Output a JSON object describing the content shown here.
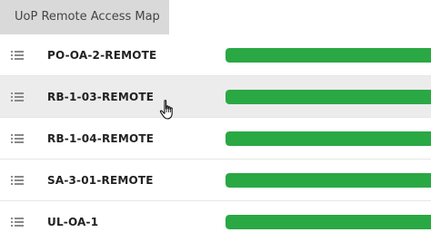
{
  "header": {
    "tab_label": "UoP Remote Access Map"
  },
  "colors": {
    "bar_fill": "#2aa844",
    "hover_row": "#ececec",
    "tab_bg": "#d9d9d9"
  },
  "rows": [
    {
      "label": "PO-OA-2-REMOTE",
      "progress": 1.0,
      "icon": "list-icon"
    },
    {
      "label": "RB-1-03-REMOTE",
      "progress": 1.0,
      "icon": "list-icon",
      "hovered": true
    },
    {
      "label": "RB-1-04-REMOTE",
      "progress": 1.0,
      "icon": "list-icon"
    },
    {
      "label": "SA-3-01-REMOTE",
      "progress": 1.0,
      "icon": "list-icon"
    },
    {
      "label": "UL-OA-1",
      "progress": 1.0,
      "icon": "list-icon"
    }
  ],
  "cursor": {
    "icon": "hand-pointer-icon"
  }
}
